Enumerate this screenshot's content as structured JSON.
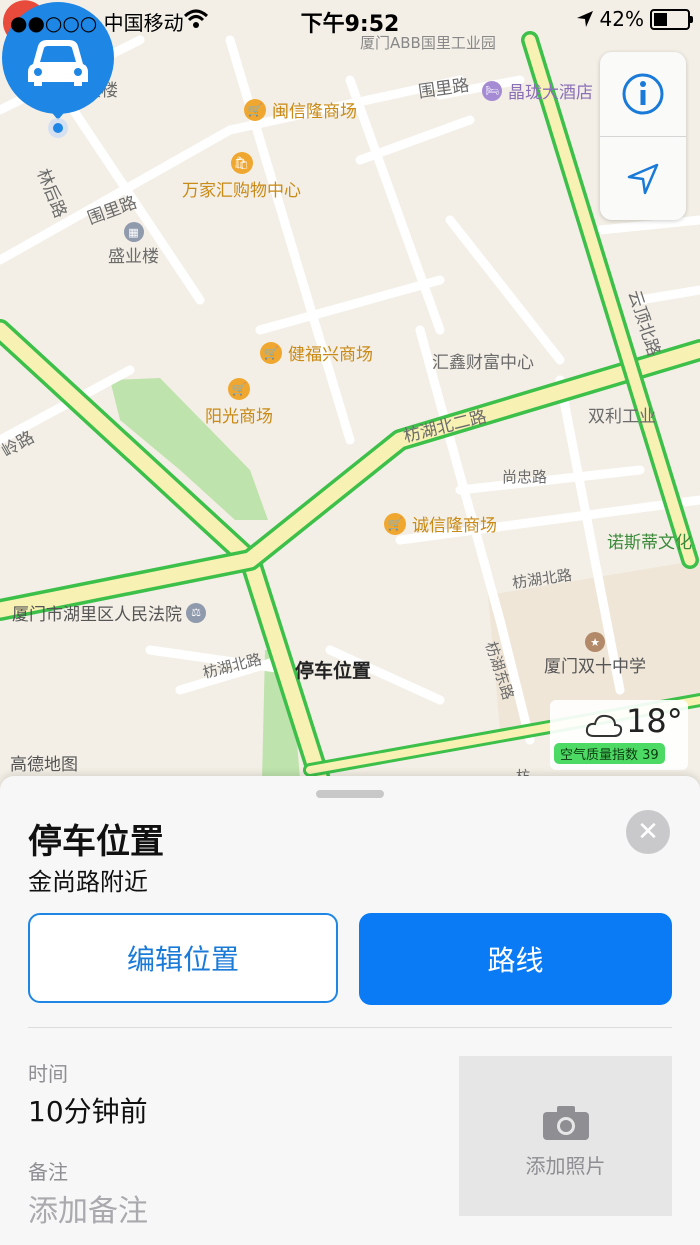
{
  "status_bar": {
    "carrier": "●●○○○ 中国移动",
    "time": "下午9:52",
    "battery": "42%",
    "battery_level": 0.42,
    "icons": [
      "signal-dots-icon",
      "wifi-icon",
      "location-arrow-icon",
      "battery-icon"
    ]
  },
  "map": {
    "labels": {
      "top_cut": "厦门ABB国里工业园",
      "fengzhan": "锋展大楼",
      "minxinlong": "闽信隆商场",
      "weili_top": "围里路",
      "jinglong": "晶珑大酒店",
      "wanjiahui": "万家汇购物中心",
      "linhou": "林后路",
      "weili_left": "围里路",
      "shengye": "盛业楼",
      "yundingbei": "云顶北路",
      "jianfuxing": "健福兴商场",
      "huixin": "汇鑫财富中心",
      "yangguang": "阳光商场",
      "shuangli": "双利工业",
      "fanghubei2": "枋湖北二路",
      "ling": "岭路",
      "shangzhong": "尚忠路",
      "chengxinlong": "诚信隆商场",
      "nuosidi": "诺斯蒂文化",
      "fanghubei_right": "枋湖北路",
      "court": "厦门市湖里区人民法院",
      "fanghudong": "枋湖东路",
      "fanghubei_left": "枋湖北路",
      "shuangshi": "厦门双十中学",
      "parked": "停车位置",
      "brand": "高德地图",
      "fang_cut": "枋"
    },
    "weather": {
      "temperature": "18°",
      "aqi": "空气质量指数 39",
      "icon": "cloud-icon"
    },
    "controls": {
      "info_icon": "info-icon",
      "locate_icon": "location-arrow-icon"
    }
  },
  "sheet": {
    "title": "停车位置",
    "subtitle": "金尚路附近",
    "edit_button": "编辑位置",
    "route_button": "路线",
    "time_label": "时间",
    "time_value": "10分钟前",
    "note_label": "备注",
    "note_placeholder": "添加备注",
    "add_photo": "添加照片"
  },
  "colors": {
    "accent": "#0a7bf5",
    "road_green": "#3cc04a",
    "road_yellow": "#f7f1b4",
    "poi": "#c98a16",
    "pin_red": "#e84a3c",
    "pin_blue": "#1e86e5",
    "aqi_green": "#4cd964"
  }
}
